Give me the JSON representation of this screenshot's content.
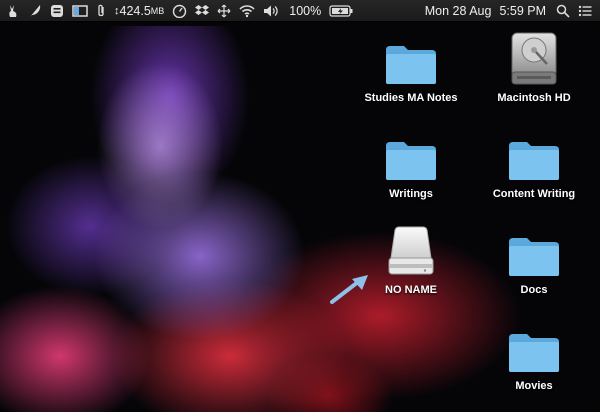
{
  "menubar": {
    "items": [
      {
        "name": "rabbit-icon"
      },
      {
        "name": "feather-icon"
      },
      {
        "name": "app-menu-icon"
      },
      {
        "name": "display-icon"
      },
      {
        "name": "paperclip-icon"
      }
    ],
    "network_speed": "424.5",
    "network_unit": "MB",
    "battery_percent": "100%",
    "date": "Mon 28 Aug",
    "time": "5:59 PM"
  },
  "desktop": {
    "icons": [
      {
        "label": "Studies MA Notes",
        "type": "folder"
      },
      {
        "label": "Macintosh HD",
        "type": "hard-drive"
      },
      {
        "label": "Writings",
        "type": "folder"
      },
      {
        "label": "Content Writing",
        "type": "folder"
      },
      {
        "label": "NO NAME",
        "type": "external-drive"
      },
      {
        "label": "Docs",
        "type": "folder"
      },
      {
        "label": "Movies",
        "type": "folder"
      }
    ],
    "annotation": {
      "name": "pointer-arrow",
      "color": "#8fc0ea"
    }
  },
  "colors": {
    "folder_front": "#7cc3ef",
    "folder_back": "#5aa8dc",
    "menubar": "#1e1e1e"
  }
}
